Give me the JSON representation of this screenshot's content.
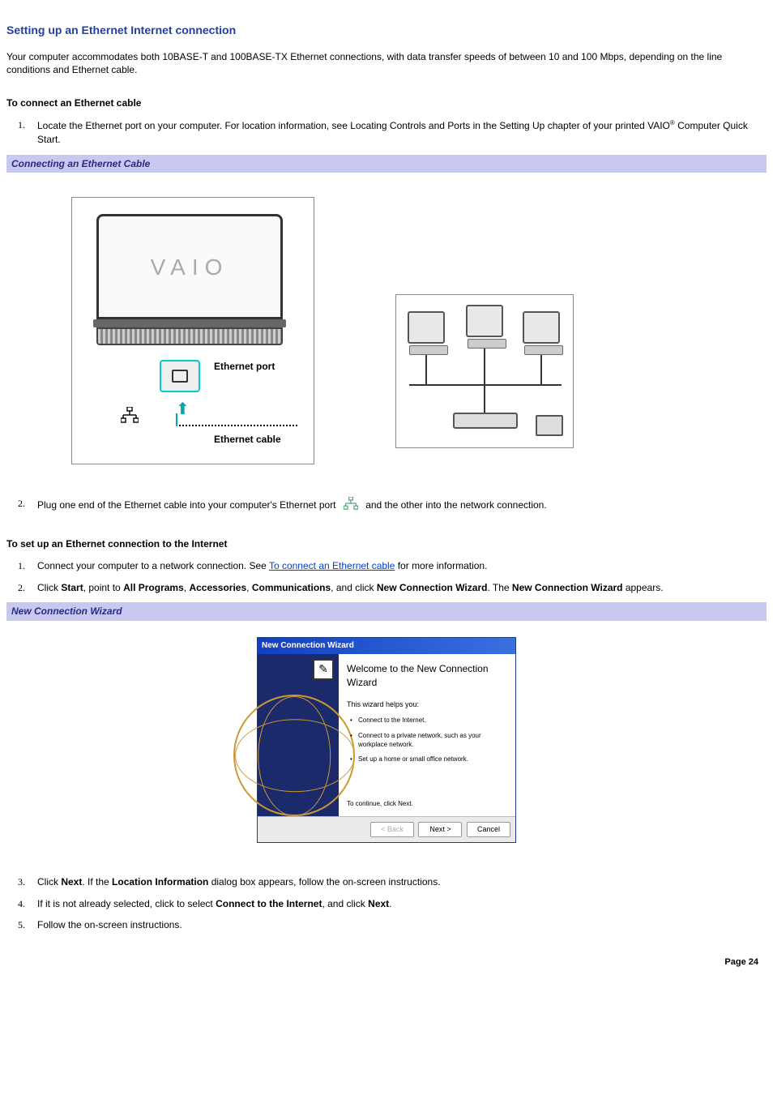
{
  "title": "Setting up an Ethernet Internet connection",
  "intro": "Your computer accommodates both 10BASE-T and 100BASE-TX Ethernet connections, with data transfer speeds of between 10 and 100 Mbps, depending on the line conditions and Ethernet cable.",
  "section1": {
    "heading": "To connect an Ethernet cable",
    "step1_pre": "Locate the Ethernet port on your computer. For location information, see Locating Controls and Ports in the Setting Up chapter of your printed VAIO",
    "step1_post": " Computer Quick Start.",
    "banner": "Connecting an Ethernet Cable",
    "diagram": {
      "logo": "VAIO",
      "port_label": "Ethernet port",
      "cable_label": "Ethernet cable"
    },
    "step2_pre": "Plug one end of the Ethernet cable into your computer's Ethernet port ",
    "step2_post": " and the other into the network connection."
  },
  "section2": {
    "heading": "To set up an Ethernet connection to the Internet",
    "step1_pre": "Connect your computer to a network connection. See ",
    "step1_link": "To connect an Ethernet cable",
    "step1_post": " for more information.",
    "step2": {
      "t1": "Click ",
      "b1": "Start",
      "t2": ", point to ",
      "b2": "All Programs",
      "t3": ", ",
      "b3": "Accessories",
      "t4": ", ",
      "b4": "Communications",
      "t5": ", and click ",
      "b5": "New Connection Wizard",
      "t6": ". The ",
      "b6": "New Connection Wizard",
      "t7": " appears."
    },
    "banner": "New Connection Wizard",
    "wizard": {
      "titlebar": "New Connection Wizard",
      "heading": "Welcome to the New Connection Wizard",
      "sub": "This wizard helps you:",
      "b1": "Connect to the Internet.",
      "b2": "Connect to a private network, such as your workplace network.",
      "b3": "Set up a home or small office network.",
      "continue": "To continue, click Next.",
      "back": "< Back",
      "next": "Next >",
      "cancel": "Cancel"
    },
    "step3": {
      "t1": "Click ",
      "b1": "Next",
      "t2": ". If the ",
      "b2": "Location Information",
      "t3": " dialog box appears, follow the on-screen instructions."
    },
    "step4": {
      "t1": "If it is not already selected, click to select ",
      "b1": "Connect to the Internet",
      "t2": ", and click ",
      "b2": "Next",
      "t3": "."
    },
    "step5": "Follow the on-screen instructions."
  },
  "page": "Page 24",
  "registered": "®"
}
